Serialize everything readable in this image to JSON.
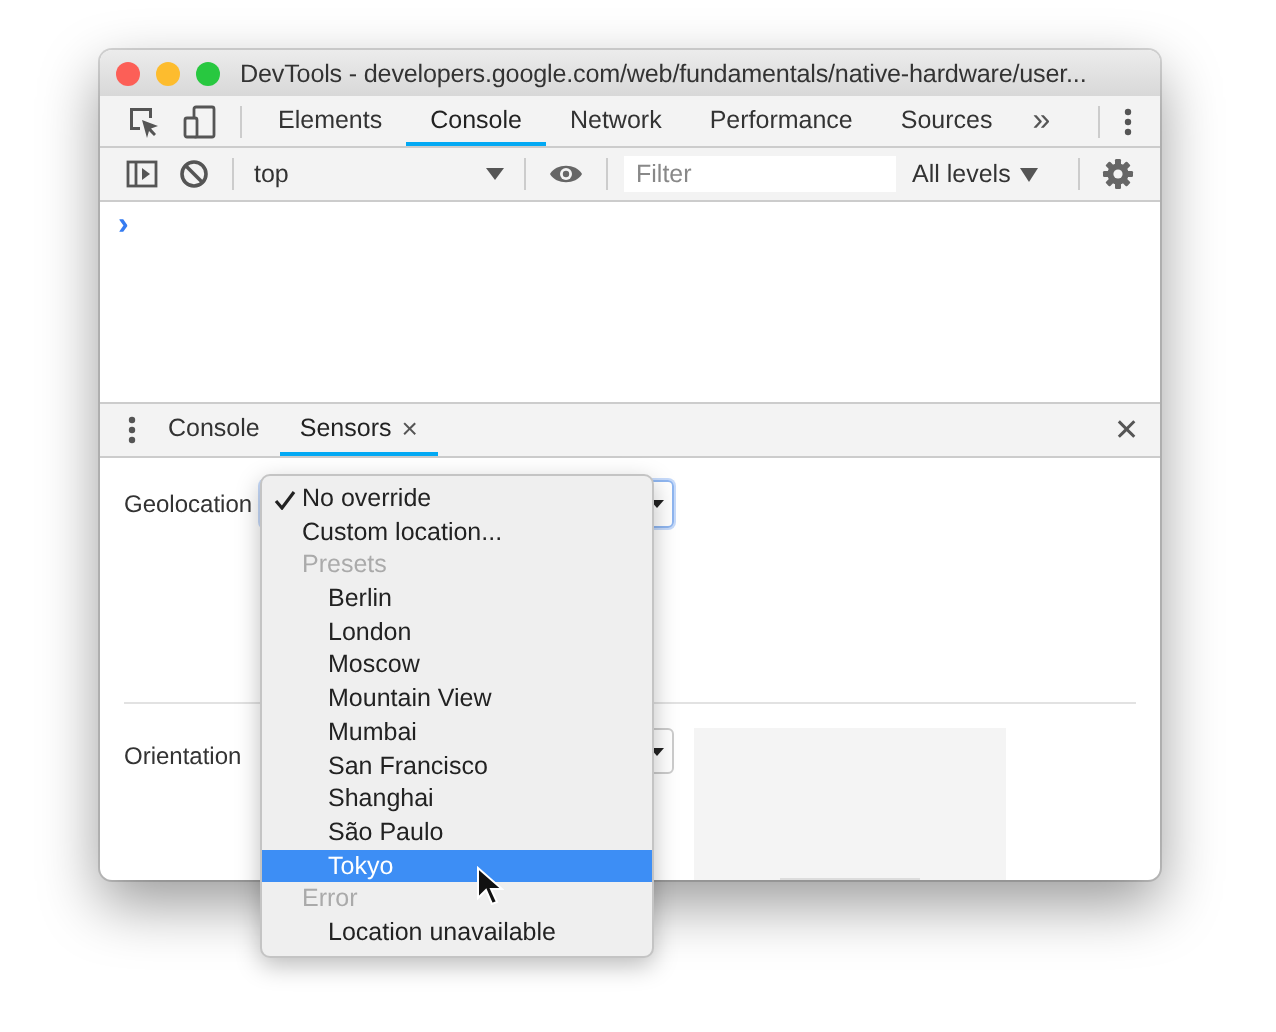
{
  "window": {
    "title": "DevTools - developers.google.com/web/fundamentals/native-hardware/user..."
  },
  "main_tabs": [
    {
      "label": "Elements",
      "selected": false
    },
    {
      "label": "Console",
      "selected": true
    },
    {
      "label": "Network",
      "selected": false
    },
    {
      "label": "Performance",
      "selected": false
    },
    {
      "label": "Sources",
      "selected": false
    }
  ],
  "more_tabs": "»",
  "console_toolbar": {
    "context": "top",
    "filter": {
      "placeholder": "Filter"
    },
    "levels": "All levels"
  },
  "console": {
    "prompt": "›"
  },
  "drawer_tabs": [
    {
      "label": "Console",
      "selected": false
    },
    {
      "label": "Sensors",
      "selected": true,
      "close": "×"
    }
  ],
  "drawer_close": "✕",
  "sensors": {
    "geolocation_label": "Geolocation",
    "orientation_label": "Orientation"
  },
  "dropdown": [
    {
      "kind": "option",
      "label": "No override",
      "checked": true,
      "selected": false
    },
    {
      "kind": "option",
      "label": "Custom location...",
      "checked": false,
      "selected": false
    },
    {
      "kind": "header",
      "label": "Presets"
    },
    {
      "kind": "preset",
      "label": "Berlin",
      "checked": false,
      "selected": false
    },
    {
      "kind": "preset",
      "label": "London",
      "checked": false,
      "selected": false
    },
    {
      "kind": "preset",
      "label": "Moscow",
      "checked": false,
      "selected": false
    },
    {
      "kind": "preset",
      "label": "Mountain View",
      "checked": false,
      "selected": false
    },
    {
      "kind": "preset",
      "label": "Mumbai",
      "checked": false,
      "selected": false
    },
    {
      "kind": "preset",
      "label": "San Francisco",
      "checked": false,
      "selected": false
    },
    {
      "kind": "preset",
      "label": "Shanghai",
      "checked": false,
      "selected": false
    },
    {
      "kind": "preset",
      "label": "São Paulo",
      "checked": false,
      "selected": false
    },
    {
      "kind": "preset",
      "label": "Tokyo",
      "checked": false,
      "selected": true
    },
    {
      "kind": "header",
      "label": "Error"
    },
    {
      "kind": "preset",
      "label": "Location unavailable",
      "checked": false,
      "selected": false
    }
  ]
}
